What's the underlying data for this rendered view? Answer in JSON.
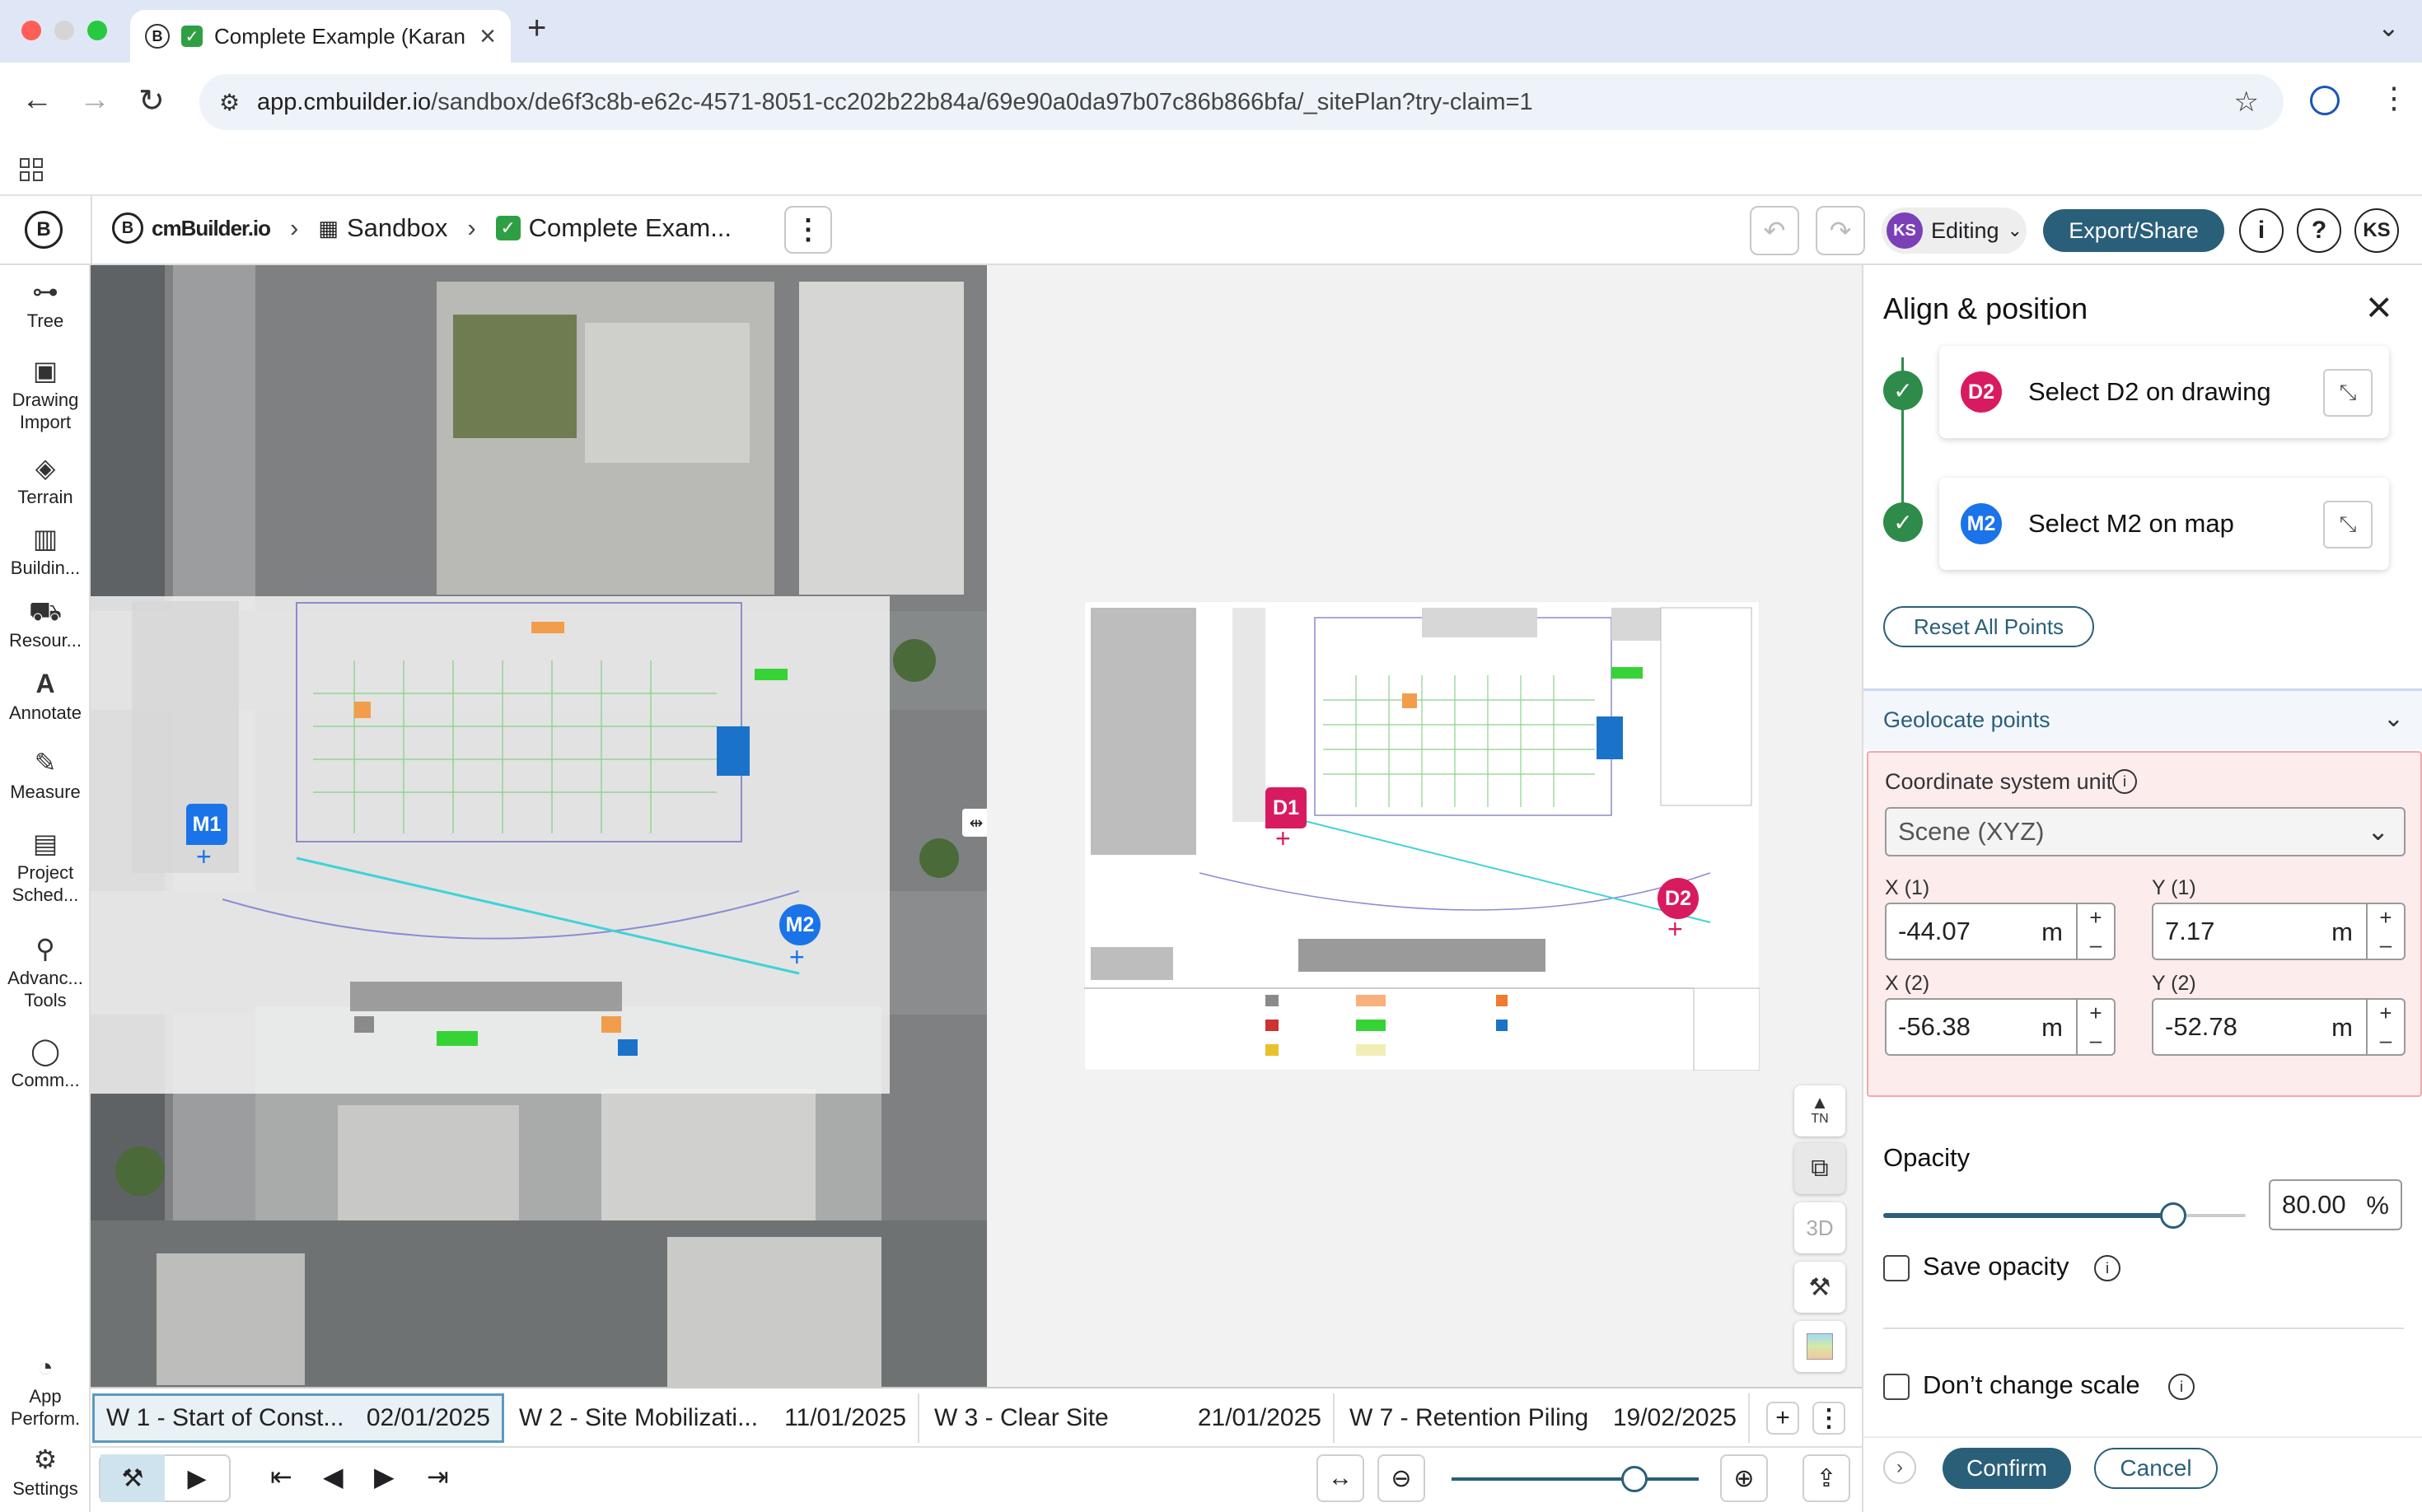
{
  "browser": {
    "tab_title": "Complete Example (Karan",
    "url_host": "app.cmbuilder.io",
    "url_path": "/sandbox/de6f3c8b-e62c-4571-8051-cc202b22b84a/69e90a0da97b07c86b866bfa/_sitePlan?try-claim=1"
  },
  "header": {
    "logo_text": "cmBuilder.io",
    "crumb_sandbox": "Sandbox",
    "crumb_project": "Complete Exam...",
    "editing_initials": "KS",
    "editing_label": "Editing",
    "export_label": "Export/Share",
    "user_initials": "KS"
  },
  "rail": [
    {
      "label": "Tree",
      "icon": "tree-icon"
    },
    {
      "label": "Drawing Import",
      "icon": "image-icon"
    },
    {
      "label": "Terrain",
      "icon": "layers-icon"
    },
    {
      "label": "Buildin...",
      "icon": "building-icon"
    },
    {
      "label": "Resour...",
      "icon": "resources-icon"
    },
    {
      "label": "Annotate",
      "icon": "annotate-icon"
    },
    {
      "label": "Measure",
      "icon": "ruler-icon"
    },
    {
      "label": "Project Sched...",
      "icon": "calendar-icon"
    },
    {
      "label": "Advanc... Tools",
      "icon": "tools-icon"
    },
    {
      "label": "Comm...",
      "icon": "comment-icon"
    },
    {
      "label": "App Perform.",
      "icon": "gauge-icon"
    },
    {
      "label": "Settings",
      "icon": "gear-icon"
    }
  ],
  "map": {
    "marker_m1": "M1",
    "marker_m2": "M2",
    "marker_d1": "D1",
    "marker_d2": "D2",
    "btn_3d": "3D",
    "btn_tn": "TN"
  },
  "panel": {
    "title": "Align & position",
    "step_d2": {
      "badge": "D2",
      "label": "Select D2 on drawing"
    },
    "step_m2": {
      "badge": "M2",
      "label": "Select M2 on map"
    },
    "reset_label": "Reset All Points",
    "geolocate_label": "Geolocate points",
    "coord_unit_label": "Coordinate system unit",
    "coord_unit_value": "Scene (XYZ)",
    "x1_label": "X (1)",
    "x1_value": "-44.07",
    "y1_label": "Y (1)",
    "y1_value": "7.17",
    "x2_label": "X (2)",
    "x2_value": "-56.38",
    "y2_label": "Y (2)",
    "y2_value": "-52.78",
    "unit_m": "m",
    "opacity_label": "Opacity",
    "opacity_value": "80.00",
    "opacity_unit": "%",
    "opacity_level": 0.8,
    "save_opacity_label": "Save opacity",
    "dont_change_scale_label": "Don’t change scale",
    "confirm_label": "Confirm",
    "cancel_label": "Cancel"
  },
  "timeline": [
    {
      "name": "W 1 - Start of Const...",
      "date": "02/01/2025"
    },
    {
      "name": "W 2 - Site Mobilizati...",
      "date": "11/01/2025"
    },
    {
      "name": "W 3 - Clear Site",
      "date": "21/01/2025"
    },
    {
      "name": "W 7 - Retention Piling",
      "date": "19/02/2025"
    }
  ],
  "colors": {
    "accent": "#2a5f7a",
    "marker_m": "#1a73e8",
    "marker_d": "#d81b60",
    "check": "#2e8b4a",
    "highlight_bg": "#fdecec"
  }
}
